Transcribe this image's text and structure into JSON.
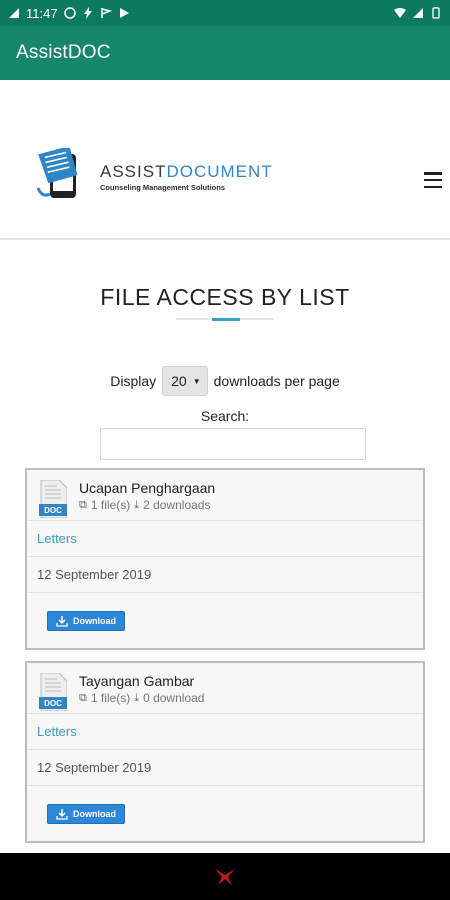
{
  "status_bar": {
    "time": "11:47"
  },
  "app_bar": {
    "title": "AssistDOC"
  },
  "header": {
    "logo_brand_part1": "ASSIST",
    "logo_brand_part2": "DOCUMENT",
    "logo_tagline": "Counseling Management Solutions"
  },
  "page": {
    "title": "FILE ACCESS BY LIST"
  },
  "controls": {
    "display_label": "Display",
    "display_value": "20",
    "display_suffix": "downloads per page",
    "search_label": "Search:",
    "search_value": ""
  },
  "files": [
    {
      "title": "Ucapan Penghargaan",
      "files_count": "1 file(s)",
      "downloads": "2 downloads",
      "category": "Letters",
      "date": "12 September 2019",
      "download_label": "Download",
      "doc_badge": "DOC"
    },
    {
      "title": "Tayangan Gambar",
      "files_count": "1 file(s)",
      "downloads": "0 download",
      "category": "Letters",
      "date": "12 September 2019",
      "download_label": "Download",
      "doc_badge": "DOC"
    }
  ],
  "colors": {
    "status_bar": "#0c7a5f",
    "app_bar": "#16876a",
    "accent_link": "#3a9cc0",
    "download_button": "#2d86d8"
  },
  "icons": {
    "status_left": [
      "signal-icon",
      "whatsapp-icon",
      "bolt-icon",
      "flag-icon",
      "play-icon"
    ],
    "status_right": [
      "wifi-icon",
      "cell-signal-icon",
      "battery-icon"
    ],
    "menu": "hamburger-menu-icon",
    "file": "doc-file-icon",
    "download": "download-icon",
    "nav": "app-logo-icon"
  }
}
